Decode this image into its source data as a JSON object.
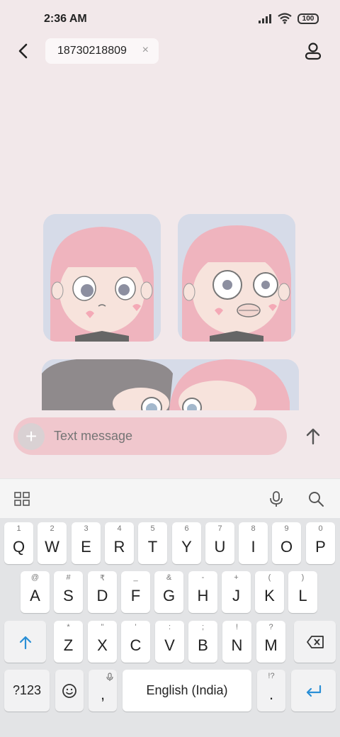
{
  "status": {
    "time": "2:36 AM",
    "battery": "100"
  },
  "header": {
    "recipient": "18730218809",
    "chip_close": "×"
  },
  "compose": {
    "placeholder": "Text message",
    "add_symbol": "+"
  },
  "keyboard": {
    "row1": [
      {
        "hint": "1",
        "label": "Q"
      },
      {
        "hint": "2",
        "label": "W"
      },
      {
        "hint": "3",
        "label": "E"
      },
      {
        "hint": "4",
        "label": "R"
      },
      {
        "hint": "5",
        "label": "T"
      },
      {
        "hint": "6",
        "label": "Y"
      },
      {
        "hint": "7",
        "label": "U"
      },
      {
        "hint": "8",
        "label": "I"
      },
      {
        "hint": "9",
        "label": "O"
      },
      {
        "hint": "0",
        "label": "P"
      }
    ],
    "row2": [
      {
        "hint": "@",
        "label": "A"
      },
      {
        "hint": "#",
        "label": "S"
      },
      {
        "hint": "₹",
        "label": "D"
      },
      {
        "hint": "_",
        "label": "F"
      },
      {
        "hint": "&",
        "label": "G"
      },
      {
        "hint": "-",
        "label": "H"
      },
      {
        "hint": "+",
        "label": "J"
      },
      {
        "hint": "(",
        "label": "K"
      },
      {
        "hint": ")",
        "label": "L"
      }
    ],
    "row3": [
      {
        "hint": "*",
        "label": "Z"
      },
      {
        "hint": "\"",
        "label": "X"
      },
      {
        "hint": "'",
        "label": "C"
      },
      {
        "hint": ":",
        "label": "V"
      },
      {
        "hint": ";",
        "label": "B"
      },
      {
        "hint": "!",
        "label": "N"
      },
      {
        "hint": "?",
        "label": "M"
      }
    ],
    "symbols_label": "?123",
    "comma": ",",
    "space_label": "English (India)",
    "period": ".",
    "period_hint": "!?"
  }
}
